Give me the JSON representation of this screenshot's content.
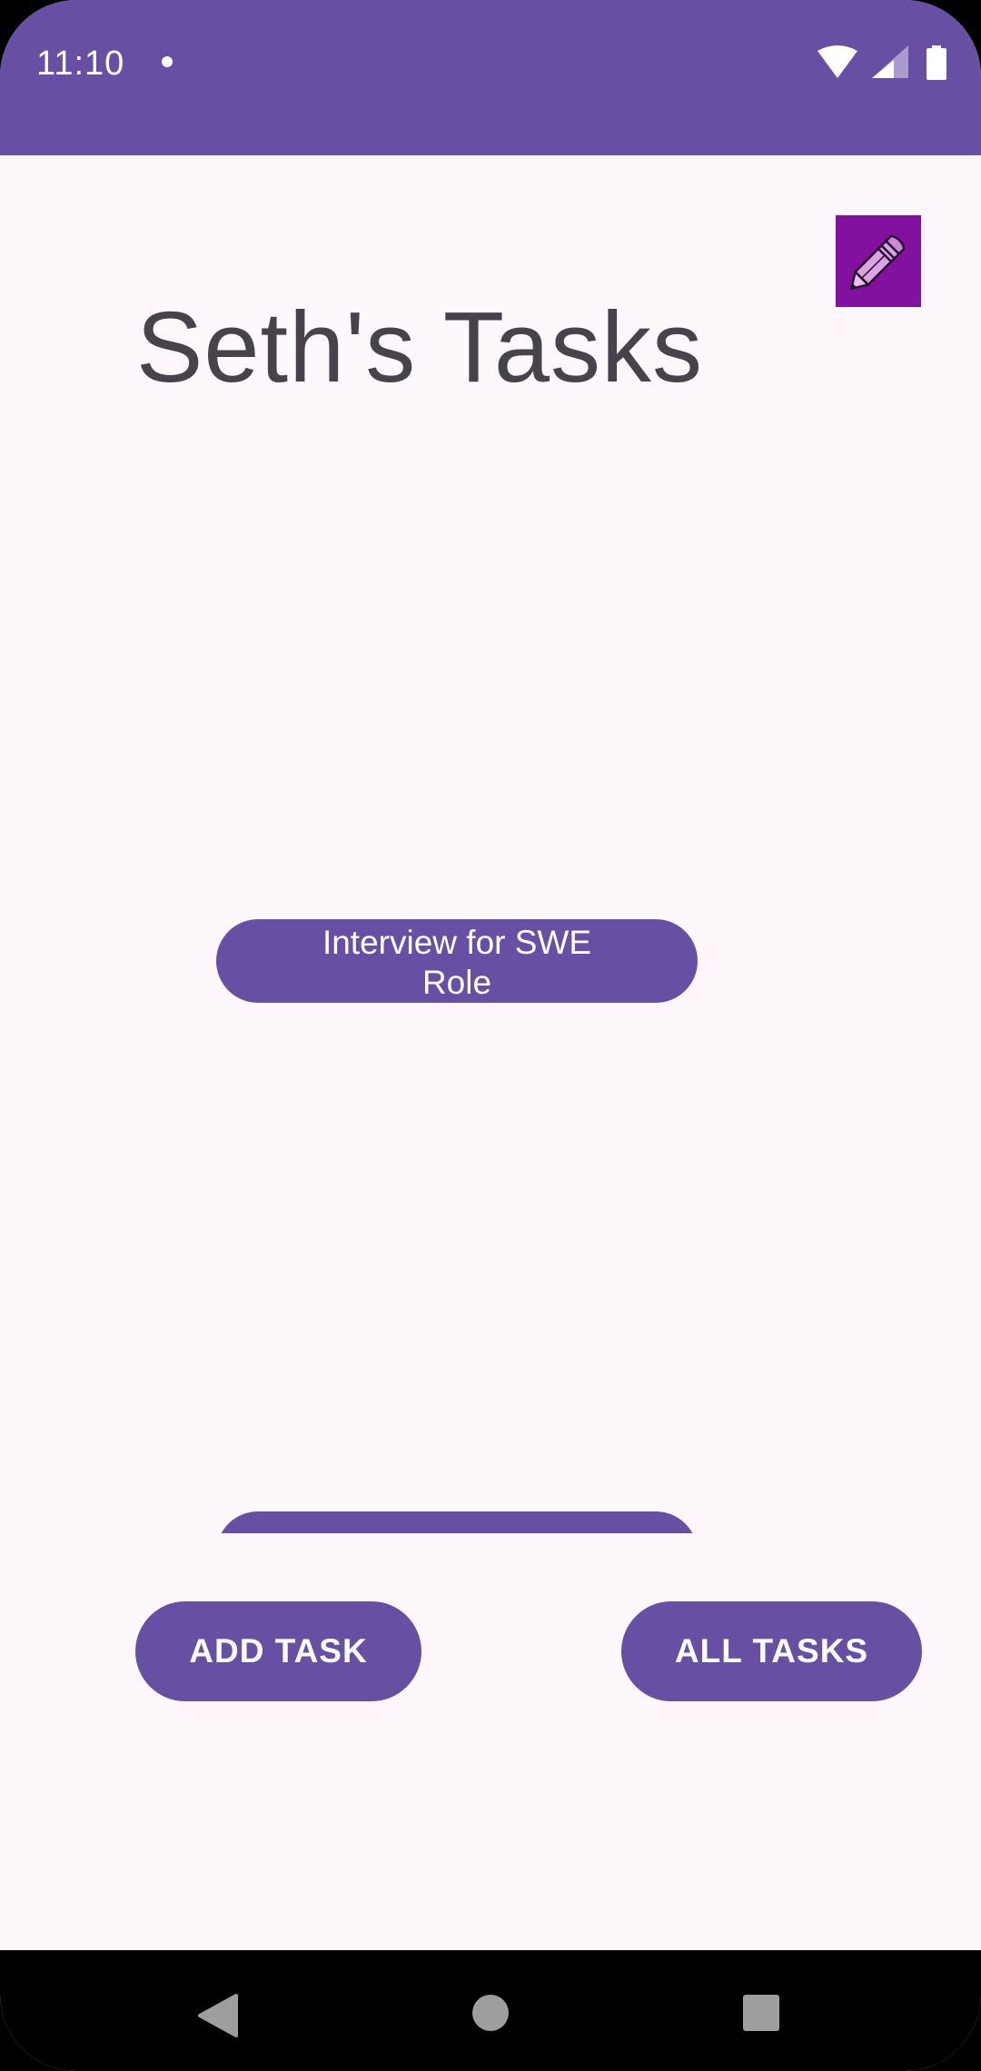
{
  "status_bar": {
    "time": "11:10",
    "icons": [
      "notification-dot-icon",
      "wifi-icon",
      "signal-icon",
      "battery-icon"
    ]
  },
  "header": {
    "title": "Seth's Tasks",
    "edit_icon": "pencil-icon"
  },
  "tasks": [
    {
      "label": "Interview for SWE Role"
    },
    {
      "label": ""
    }
  ],
  "actions": {
    "add_task_label": "ADD TASK",
    "all_tasks_label": "ALL TASKS"
  },
  "navigation": {
    "buttons": [
      "back-icon",
      "home-icon",
      "recents-icon"
    ]
  },
  "colors": {
    "primary": "#6750A4",
    "background": "#FEF7FB",
    "edit_button": "#8211A0",
    "title_text": "#46434D"
  }
}
